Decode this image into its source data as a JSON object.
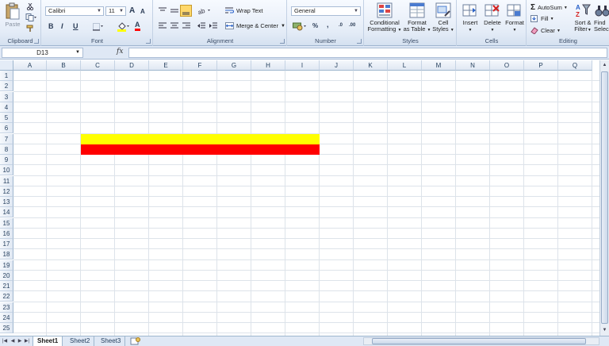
{
  "ribbon": {
    "clipboard": {
      "label": "Clipboard",
      "paste": "Paste"
    },
    "font": {
      "label": "Font",
      "family": "Calibri",
      "size": "11",
      "bold": "B",
      "italic": "I",
      "underline": "U",
      "grow": "A",
      "shrink": "A",
      "font_color": "A"
    },
    "alignment": {
      "label": "Alignment",
      "wrap_text": "Wrap Text",
      "merge_center": "Merge & Center"
    },
    "number": {
      "label": "Number",
      "format": "General",
      "percent": "%",
      "comma": ",",
      "inc_decimal": ".0",
      "dec_decimal": ".00"
    },
    "styles": {
      "label": "Styles",
      "conditional": "Conditional",
      "conditional2": "Formatting",
      "format_table": "Format",
      "format_table2": "as Table",
      "cell_styles": "Cell",
      "cell_styles2": "Styles"
    },
    "cells": {
      "label": "Cells",
      "insert": "Insert",
      "delete": "Delete",
      "format": "Format"
    },
    "editing": {
      "label": "Editing",
      "autosum": "AutoSum",
      "fill": "Fill",
      "clear": "Clear",
      "sort_filter": "Sort &",
      "sort_filter2": "Filter",
      "find_select": "Find",
      "find_select2": "Selec"
    }
  },
  "formula_bar": {
    "name_box": "D13",
    "fx": "fx",
    "formula": ""
  },
  "grid": {
    "columns": [
      "A",
      "B",
      "C",
      "D",
      "E",
      "F",
      "G",
      "H",
      "I",
      "J",
      "K",
      "L",
      "M",
      "N",
      "O",
      "P",
      "Q"
    ],
    "rows": [
      "1",
      "2",
      "3",
      "4",
      "5",
      "6",
      "7",
      "8",
      "9",
      "10",
      "11",
      "12",
      "13",
      "14",
      "15",
      "16",
      "17",
      "18",
      "19",
      "20",
      "21",
      "22",
      "23",
      "24",
      "25"
    ]
  },
  "fills": [
    {
      "row": "7",
      "from": "C",
      "to": "I",
      "color": "#ffff00"
    },
    {
      "row": "8",
      "from": "C",
      "to": "I",
      "color": "#ff0000"
    }
  ],
  "sheets": {
    "tabs": [
      "Sheet1",
      "Sheet2",
      "Sheet3"
    ],
    "active": "Sheet1"
  },
  "colors": {
    "ribbon_bg": "#e4ecf7",
    "header_bg": "#e0e8f3",
    "yellow": "#ffff00",
    "red": "#ff0000"
  }
}
